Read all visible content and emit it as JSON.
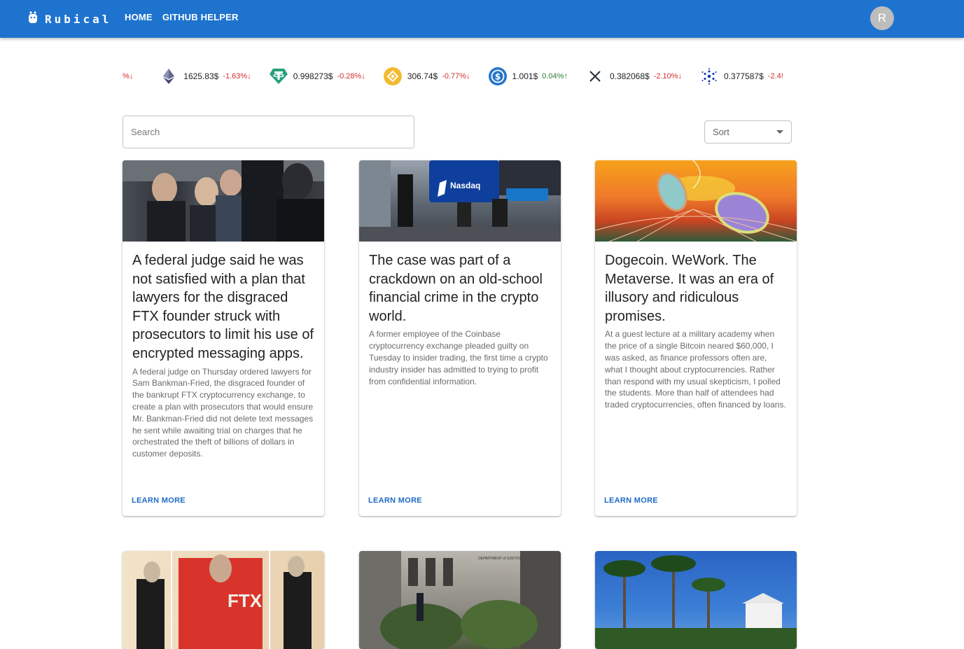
{
  "header": {
    "brand": "Rubical",
    "nav": [
      "HOME",
      "GITHUB HELPER"
    ],
    "avatar_initial": "R"
  },
  "ticker": [
    {
      "icon": "arrow-down-icon",
      "price": "",
      "change": "%↓",
      "direction": "down",
      "color": "#d32f2f"
    },
    {
      "icon": "ethereum-icon",
      "price": "1625.83$",
      "change": "-1.63%↓",
      "direction": "down",
      "color": "#d32f2f"
    },
    {
      "icon": "tether-icon",
      "price": "0.998273$",
      "change": "-0.28%↓",
      "direction": "down",
      "color": "#d32f2f"
    },
    {
      "icon": "bnb-icon",
      "price": "306.74$",
      "change": "-0.77%↓",
      "direction": "down",
      "color": "#d32f2f"
    },
    {
      "icon": "usdc-icon",
      "price": "1.001$",
      "change": "0.04%↑",
      "direction": "up",
      "color": "#2e7d32"
    },
    {
      "icon": "xrp-icon",
      "price": "0.382068$",
      "change": "-2.10%↓",
      "direction": "down",
      "color": "#d32f2f"
    },
    {
      "icon": "cardano-icon",
      "price": "0.377587$",
      "change": "-2.4!",
      "direction": "down",
      "color": "#d32f2f"
    }
  ],
  "search": {
    "placeholder": "Search"
  },
  "sort": {
    "label": "Sort"
  },
  "cards": [
    {
      "title": "A federal judge said he was not satisfied with a plan that lawyers for the disgraced FTX founder struck with prosecutors to limit his use of encrypted messaging apps.",
      "description": "A federal judge on Thursday ordered lawyers for Sam Bankman-Fried, the disgraced founder of the bankrupt FTX cryptocurrency exchange, to create a plan with prosecutors that would ensure Mr. Bankman-Fried did not delete text messages he sent while awaiting trial on charges that he orchestrated the theft of billions of dollars in customer deposits.",
      "action": "LEARN MORE",
      "image_label": "",
      "image": "courthouse-crowd-photo"
    },
    {
      "title": "The case was part of a crackdown on an old-school financial crime in the crypto world.",
      "description": "A former employee of the Coinbase cryptocurrency exchange pleaded guilty on Tuesday to insider trading, the first time a crypto industry insider has admitted to trying to profit from confidential information.",
      "action": "LEARN MORE",
      "image_label": "Nasdaq",
      "image": "times-square-nasdaq-photo"
    },
    {
      "title": "Dogecoin. WeWork. The Metaverse. It was an era of illusory and ridiculous promises.",
      "description": "At a guest lecture at a military academy when the price of a single Bitcoin neared $60,000, I was asked, as finance professors often are, what I thought about cryptocurrencies. Rather than respond with my usual skepticism, I polled the students. More than half of attendees had traded cryptocurrencies, often financed by loans.",
      "action": "LEARN MORE",
      "image_label": "",
      "image": "metaverse-illustration"
    },
    {
      "title": "",
      "description": "",
      "action": "",
      "image_label": "FTX",
      "image": "ftx-collage-illustration"
    },
    {
      "title": "",
      "description": "",
      "action": "",
      "image_label": "DEPARTMENT of JUSTICE",
      "image": "doj-building-photo"
    },
    {
      "title": "",
      "description": "",
      "action": "",
      "image_label": "",
      "image": "palm-trees-photo"
    }
  ]
}
